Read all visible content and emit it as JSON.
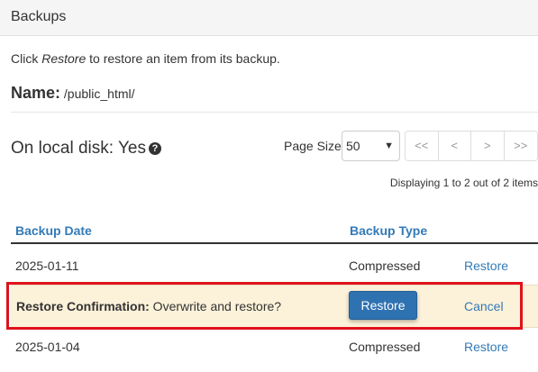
{
  "header": {
    "title": "Backups"
  },
  "instructions": {
    "before": "Click ",
    "emphasis": "Restore",
    "after": " to restore an item from its backup."
  },
  "name": {
    "label": "Name:",
    "value": "/public_html/"
  },
  "local_disk": {
    "text": "On local disk: Yes",
    "icon": "question-circle-icon"
  },
  "pagination": {
    "page_size_label": "Page Size",
    "page_size_value": "50",
    "first": "<<",
    "prev": "<",
    "next": ">",
    "last": ">>",
    "display_text": "Displaying 1 to 2 out of 2 items"
  },
  "table": {
    "headers": {
      "date": "Backup Date",
      "type": "Backup Type"
    },
    "rows": [
      {
        "date": "2025-01-11",
        "type": "Compressed",
        "action": "Restore"
      },
      {
        "date": "2025-01-04",
        "type": "Compressed",
        "action": "Restore"
      }
    ],
    "confirmation": {
      "label": "Restore Confirmation:",
      "message": " Overwrite and restore?",
      "confirm_button": "Restore",
      "cancel_link": "Cancel"
    }
  },
  "colors": {
    "link": "#337ab7",
    "button": "#2f72b2",
    "confirm_bg": "#fcf1d9",
    "highlight": "#e0121b"
  }
}
